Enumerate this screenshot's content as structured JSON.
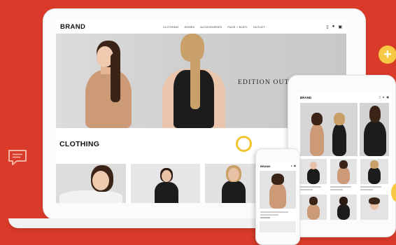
{
  "site": {
    "brand": "BRAND",
    "menu": [
      "CLOTHING",
      "SHOES",
      "ACCESSORIES",
      "FACE + BODY",
      "OUTLET"
    ],
    "hero_text": "EDITION OUTE",
    "section_title": "CLOTHING"
  },
  "tablet": {
    "brand": "BRAND"
  },
  "phone": {
    "brand": "BRAND"
  },
  "icons": [
    "phone-icon",
    "account-icon",
    "cart-icon",
    "plus-icon",
    "chat-bubble-icon"
  ],
  "colors": {
    "background": "#d93a29",
    "accent_yellow": "#f7c844",
    "ring_yellow": "#f0c433",
    "tan_dress": "#cd9a78",
    "black_dress": "#1c1c1c"
  }
}
